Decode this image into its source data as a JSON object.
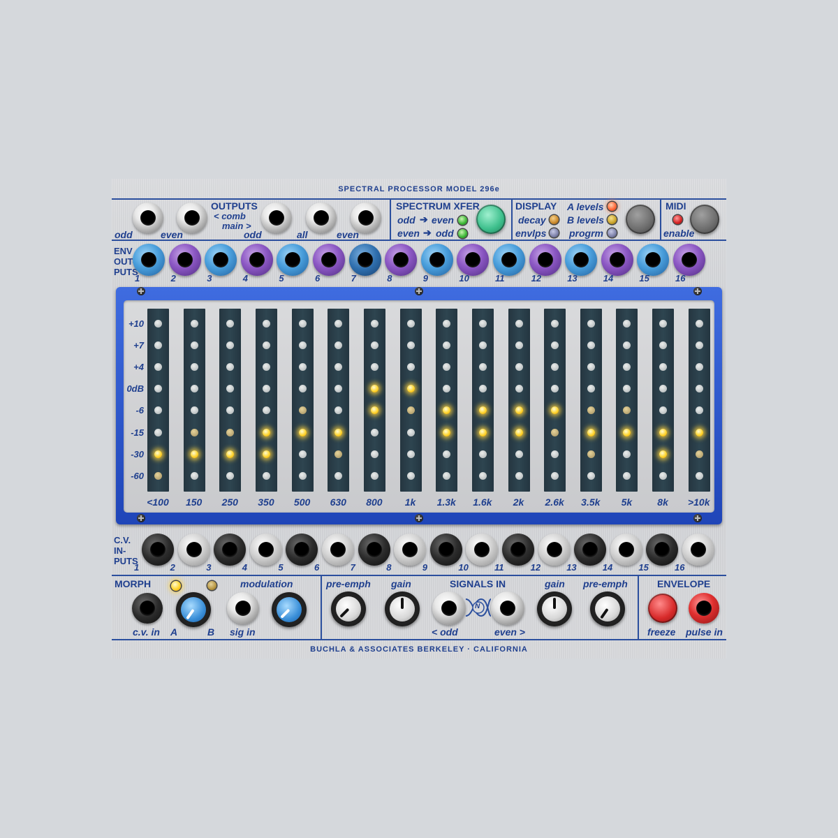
{
  "title": "SPECTRAL PROCESSOR MODEL  296e",
  "footer": "BUCHLA & ASSOCIATES    BERKELEY · CALIFORNIA",
  "outputs": {
    "heading": "OUTPUTS",
    "comb": "< comb",
    "main": "main >",
    "labels": [
      "odd",
      "even",
      "odd",
      "all",
      "even"
    ]
  },
  "spectrum_xfer": {
    "heading": "SPECTRUM XFER",
    "odd_to_even": "odd",
    "odd_to_even_2": "even",
    "even_to_odd": "even",
    "even_to_odd_2": "odd",
    "arrow": "➔"
  },
  "display": {
    "heading": "DISPLAY",
    "decay": "decay",
    "envlps": "envlps",
    "a_levels": "A levels",
    "b_levels": "B levels",
    "progrm": "progrm"
  },
  "midi": {
    "heading": "MIDI",
    "enable": "enable"
  },
  "env_outputs": {
    "label1": "ENV",
    "label2": "OUT-",
    "label3": "PUTS",
    "numbers": [
      "1",
      "2",
      "3",
      "4",
      "5",
      "6",
      "7",
      "8",
      "9",
      "10",
      "11",
      "12",
      "13",
      "14",
      "15",
      "16"
    ],
    "colors": [
      "blue",
      "purple",
      "blue",
      "purple",
      "blue",
      "purple",
      "dblue",
      "purple",
      "blue",
      "purple",
      "blue",
      "purple",
      "blue",
      "purple",
      "blue",
      "purple"
    ]
  },
  "meter": {
    "scale": [
      "+10",
      "+7",
      "+4",
      "0dB",
      "-6",
      "-15",
      "-30",
      "-60"
    ],
    "bands": [
      "<100",
      "150",
      "250",
      "350",
      "500",
      "630",
      "800",
      "1k",
      "1.3k",
      "1.6k",
      "2k",
      "2.6k",
      "3.5k",
      "5k",
      "8k",
      ">10k"
    ],
    "levels": [
      [
        "off",
        "off",
        "off",
        "off",
        "off",
        "off",
        "lit",
        "dim"
      ],
      [
        "off",
        "off",
        "off",
        "off",
        "off",
        "dim",
        "lit",
        "off"
      ],
      [
        "off",
        "off",
        "off",
        "off",
        "off",
        "dim",
        "lit",
        "off"
      ],
      [
        "off",
        "off",
        "off",
        "off",
        "off",
        "lit",
        "lit",
        "off"
      ],
      [
        "off",
        "off",
        "off",
        "off",
        "dim",
        "lit",
        "off",
        "off"
      ],
      [
        "off",
        "off",
        "off",
        "off",
        "off",
        "lit",
        "dim",
        "off"
      ],
      [
        "off",
        "off",
        "off",
        "lit",
        "lit",
        "off",
        "off",
        "off"
      ],
      [
        "off",
        "off",
        "off",
        "lit",
        "dim",
        "off",
        "off",
        "off"
      ],
      [
        "off",
        "off",
        "off",
        "off",
        "lit",
        "lit",
        "off",
        "off"
      ],
      [
        "off",
        "off",
        "off",
        "off",
        "lit",
        "lit",
        "off",
        "off"
      ],
      [
        "off",
        "off",
        "off",
        "off",
        "lit",
        "lit",
        "off",
        "off"
      ],
      [
        "off",
        "off",
        "off",
        "off",
        "lit",
        "dim",
        "off",
        "off"
      ],
      [
        "off",
        "off",
        "off",
        "off",
        "dim",
        "lit",
        "dim",
        "off"
      ],
      [
        "off",
        "off",
        "off",
        "off",
        "dim",
        "lit",
        "off",
        "off"
      ],
      [
        "off",
        "off",
        "off",
        "off",
        "off",
        "lit",
        "lit",
        "off"
      ],
      [
        "off",
        "off",
        "off",
        "off",
        "off",
        "lit",
        "dim",
        "off"
      ]
    ]
  },
  "cv_inputs": {
    "label1": "C.V.",
    "label2": "IN-",
    "label3": "PUTS",
    "numbers": [
      "1",
      "2",
      "3",
      "4",
      "5",
      "6",
      "7",
      "8",
      "9",
      "10",
      "11",
      "12",
      "13",
      "14",
      "15",
      "16"
    ],
    "colors": [
      "black",
      "grey",
      "black",
      "grey",
      "black",
      "grey",
      "black",
      "grey",
      "black",
      "grey",
      "black",
      "grey",
      "black",
      "grey",
      "black",
      "grey"
    ]
  },
  "morph": {
    "heading": "MORPH",
    "modulation": "modulation",
    "cv_in": "c.v. in",
    "a": "A",
    "b": "B",
    "sig_in": "sig in"
  },
  "signals": {
    "heading": "SIGNALS IN",
    "pre_emph_left": "pre-emph",
    "gain_left": "gain",
    "gain_right": "gain",
    "pre_emph_right": "pre-emph",
    "odd": "< odd",
    "even": "even >",
    "n_logo": "N"
  },
  "envelope": {
    "heading": "ENVELOPE",
    "freeze": "freeze",
    "pulse_in": "pulse in"
  },
  "colors": {
    "panel_text": "#1f3f8e",
    "frame_blue": "#2a55cc",
    "led_yellow": "#ffd530",
    "green_button": "#3dbf8c"
  }
}
